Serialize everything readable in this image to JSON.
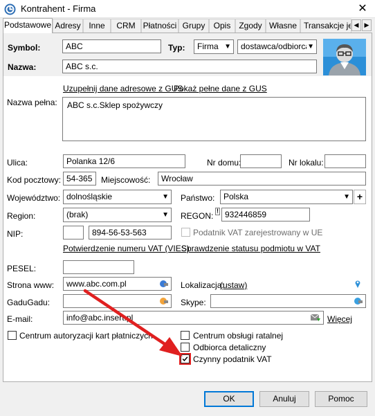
{
  "window": {
    "title": "Kontrahent - Firma",
    "close_label": "✕"
  },
  "tabs": [
    "Podstawowe",
    "Adresy",
    "Inne",
    "CRM",
    "Płatności",
    "Grupy",
    "Opis",
    "Zgody",
    "Własne",
    "Transakcje jedn"
  ],
  "tab_scroll": {
    "left": "◀",
    "right": "▶"
  },
  "header": {
    "symbol_label": "Symbol:",
    "symbol_value": "ABC",
    "typ_label": "Typ:",
    "typ_value": "Firma",
    "typ2_value": "dostawca/odbiorca",
    "nazwa_label": "Nazwa:",
    "nazwa_value": "ABC s.c."
  },
  "links": {
    "gus_fill": "Uzupełnij dane adresowe z GUS",
    "gus_show": "Pokaż pełne dane z GUS",
    "vat_confirm": "Potwierdzenie numeru VAT (VIES)",
    "vat_check": "Sprawdzenie statusu podmiotu w VAT",
    "ustaw": "(ustaw)",
    "wiecej": "Więcej"
  },
  "form": {
    "nazwa_pelna_label": "Nazwa pełna:",
    "nazwa_pelna_value": "ABC s.c.Sklep spożywczy",
    "ulica_label": "Ulica:",
    "ulica_value": "Polanka  12/6",
    "nr_domu_label": "Nr domu:",
    "nr_domu_value": "",
    "nr_lokalu_label": "Nr lokalu:",
    "nr_lokalu_value": "",
    "kod_label": "Kod pocztowy:",
    "kod_value": "54-365",
    "miejscowosc_label": "Miejscowość:",
    "miejscowosc_value": "Wrocław",
    "woj_label": "Województwo:",
    "woj_value": "dolnośląskie",
    "panstwo_label": "Państwo:",
    "panstwo_value": "Polska",
    "panstwo_add": "+",
    "region_label": "Region:",
    "region_value": "(brak)",
    "regon_label": "REGON:",
    "regon_value": "932446859",
    "regon_badge": "!",
    "nip_label": "NIP:",
    "nip_prefix": "",
    "nip_value": "894-56-53-563",
    "vat_ue_label": "Podatnik VAT zarejestrowany w UE",
    "pesel_label": "PESEL:",
    "pesel_value": "",
    "www_label": "Strona www:",
    "www_value": "www.abc.com.pl",
    "lokalizacja_label": "Lokalizacja:",
    "gadu_label": "GaduGadu:",
    "gadu_value": "",
    "skype_label": "Skype:",
    "skype_value": "",
    "email_label": "E-mail:",
    "email_value": "info@abc.insert.pl"
  },
  "checkboxes": {
    "centrum_autoryzacji": "Centrum autoryzacji kart płatniczych",
    "centrum_ratalne": "Centrum obsługi ratalnej",
    "odbiorca_detaliczny": "Odbiorca detaliczny",
    "czynny_vat": "Czynny podatnik VAT"
  },
  "buttons": {
    "ok": "OK",
    "cancel": "Anuluj",
    "help": "Pomoc"
  },
  "colors": {
    "annotation": "#e02020",
    "link_accent": "#0078d7"
  }
}
